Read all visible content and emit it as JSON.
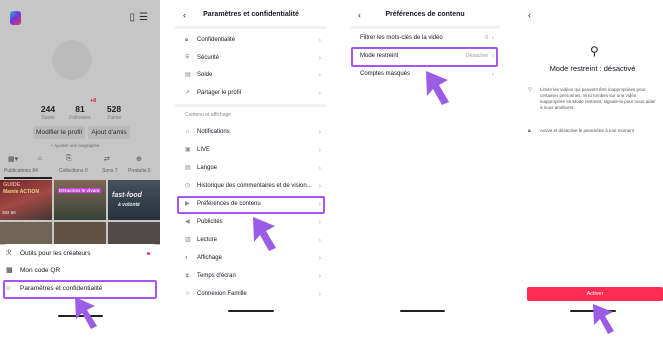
{
  "profile": {
    "stats": [
      {
        "value": "244",
        "label": "Suivis",
        "badge": ""
      },
      {
        "value": "81",
        "label": "Followers",
        "badge": "+8"
      },
      {
        "value": "528",
        "label": "J'aime",
        "badge": ""
      }
    ],
    "edit_button": "Modifier le profil",
    "add_friends_button": "Ajout d'amis",
    "bio_prompt": "+ Ajouter une biographie",
    "tabs": [
      "Publications 84",
      "Collections 0",
      "Sons 7",
      "Produits 0"
    ],
    "video_tags": [
      "GUIDE",
      "Mamie ACTION",
      "Déracinez le vivant",
      "fast-food",
      "à volonté"
    ],
    "video_count": "392.5K",
    "sheet": [
      {
        "label": "Outils pour les créateurs",
        "icon": "creator-tools-icon"
      },
      {
        "label": "Mon code QR",
        "icon": "qr-code-icon"
      },
      {
        "label": "Paramètres et confidentialité",
        "icon": "settings-icon"
      }
    ]
  },
  "settings": {
    "title": "Paramètres et confidentialité",
    "rows_top": [
      {
        "label": "Confidentialité",
        "icon": "lock-icon"
      },
      {
        "label": "Sécurité",
        "icon": "shield-icon"
      },
      {
        "label": "Solde",
        "icon": "wallet-icon"
      },
      {
        "label": "Partager le profil",
        "icon": "share-icon"
      }
    ],
    "section_label": "Contenu et affichage",
    "rows_content": [
      {
        "label": "Notifications",
        "icon": "bell-icon"
      },
      {
        "label": "LIVE",
        "icon": "live-icon"
      },
      {
        "label": "Langue",
        "icon": "language-icon"
      },
      {
        "label": "Historique des commentaires et de vision...",
        "icon": "history-icon"
      },
      {
        "label": "Préférences de contenu",
        "icon": "video-icon"
      },
      {
        "label": "Publicités",
        "icon": "megaphone-icon"
      },
      {
        "label": "Lecture",
        "icon": "playback-icon"
      },
      {
        "label": "Affichage",
        "icon": "display-icon"
      },
      {
        "label": "Temps d'écran",
        "icon": "hourglass-icon"
      },
      {
        "label": "Connexion Famille",
        "icon": "family-icon"
      }
    ]
  },
  "content_prefs": {
    "title": "Préférences de contenu",
    "rows": [
      {
        "label": "Filtrer les mots-clés de la vidéo",
        "value": "0"
      },
      {
        "label": "Mode restreint",
        "value": "Désactivé"
      },
      {
        "label": "Comptes masqués",
        "value": ""
      }
    ]
  },
  "restricted_mode": {
    "title": "Mode restreint : désactivé",
    "items": [
      {
        "icon": "filter-icon",
        "text": "Limite les vidéos qui peuvent être inappropriées pour certaines personnes. Si tu tombes sur une vidéo inappropriée en Mode restreint, signale-la pour nous aider à nous améliorer."
      },
      {
        "icon": "lock-icon",
        "text": "Active et désactive le paramètre à tout moment"
      }
    ],
    "button": "Activer"
  },
  "colors": {
    "highlight": "#a855f7",
    "arrow": "#9b5de5",
    "primary_button": "#fe2c55",
    "notification_dot": "#fe2c55"
  }
}
